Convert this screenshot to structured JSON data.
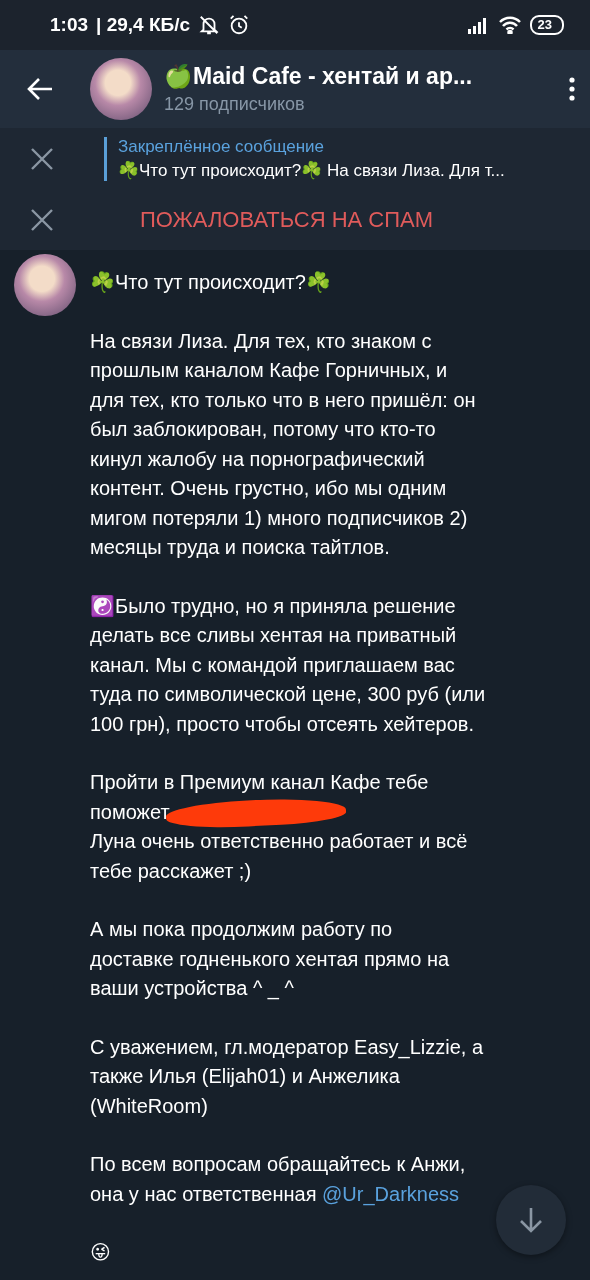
{
  "status_bar": {
    "time": "1:03",
    "speed": "| 29,4 КБ/с",
    "battery": "23"
  },
  "header": {
    "title": "🍏Maid Cafe - хентай и ар...",
    "subtitle": "129 подписчиков"
  },
  "pinned": {
    "label": "Закреплённое сообщение",
    "preview": "☘️Что тут происходит?☘️ На связи Лиза. Для т..."
  },
  "spam_bar": {
    "action": "ПОЖАЛОВАТЬСЯ НА СПАМ"
  },
  "message": {
    "paragraphs": [
      {
        "text": "☘️Что тут происходит?☘️"
      },
      {
        "text": "На связи Лиза. Для тех, кто знаком с\nпрошлым каналом Кафе Горничных, и\nдля тех, кто только что в него пришёл: он\nбыл заблокирован, потому что кто-то\nкинул жалобу на порнографический\nконтент. Очень грустно, ибо мы одним\nмигом потеряли 1) много подписчиков 2)\nмесяцы труда и поиска тайтлов."
      },
      {
        "text": "☯️Было трудно, но я приняла решение\nделать все сливы хентая на приватный\nканал. Мы с командой приглашаем вас\nтуда по символической цене, 300 руб (или\n100 грн), просто чтобы отсеять хейтеров."
      },
      {
        "text": "Пройти в Премиум канал Кафе тебе\nпоможет",
        "redacted": true,
        "after": "Луна очень ответственно работает и всё\nтебе расскажет ;)"
      },
      {
        "text": "А мы пока продолжим работу по\nдоставке годненького хентая прямо на\nваши устройства  ^ _ ^"
      },
      {
        "text": "С уважением, гл.модератор Easy_Lizzie, а\nтакже Илья (Elijah01) и Анжелика\n(WhiteRoom)"
      },
      {
        "text": "По всем вопросам обращайтесь к Анжи,\nона у нас ответственная ",
        "link": "@Ur_Darkness"
      },
      {
        "text": "😜"
      }
    ]
  }
}
